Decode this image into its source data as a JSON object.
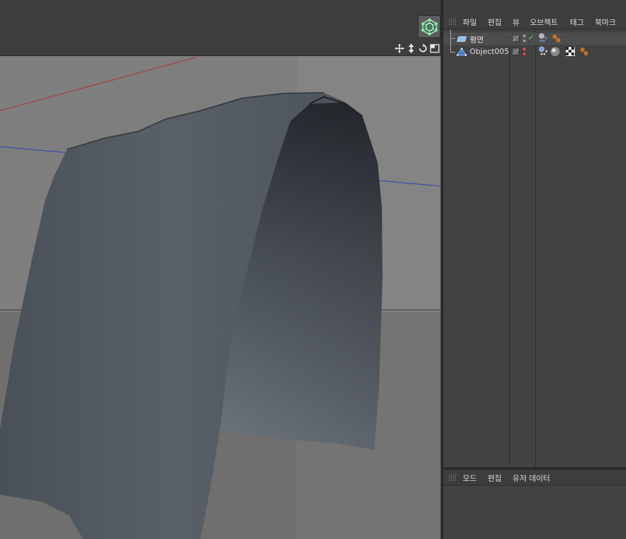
{
  "object_manager": {
    "menu": [
      "파일",
      "편집",
      "뷰",
      "오브젝트",
      "태그",
      "북마크"
    ],
    "objects": [
      {
        "name": "평면",
        "type": "plane",
        "selected": true,
        "enabled_check": "✓"
      },
      {
        "name": "Object005",
        "type": "polygon",
        "selected": false
      }
    ]
  },
  "attribute_manager": {
    "menu": [
      "모드",
      "편집",
      "유저 데이터"
    ]
  },
  "viewport": {
    "nav_icons": [
      "move-view-icon",
      "dolly-view-icon",
      "rotate-view-icon",
      "maximize-view-icon"
    ]
  },
  "colors": {
    "viewport_bg": "#7e7e7e",
    "mesh_dark": "#3f4650",
    "mesh_light": "#6a727c",
    "x_axis": "#b03030",
    "z_axis": "#2d3fb5",
    "check_green": "#5fd060"
  }
}
